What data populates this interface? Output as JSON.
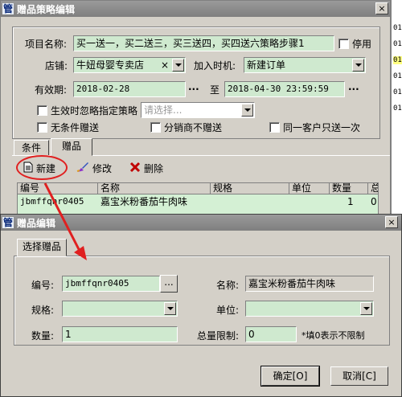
{
  "bg_window": {
    "col_values": [
      "01",
      "01",
      "01",
      "01",
      "01",
      "01"
    ]
  },
  "main_window": {
    "title": "赠品策略编辑",
    "close": "×",
    "fields": {
      "project_label": "项目名称:",
      "project_value": "买一送一，买二送三，买三送四，买四送六策略步骤1",
      "disable_label": "停用",
      "store_label": "店铺:",
      "store_value": "牛妞母婴专卖店",
      "store_clear": "×",
      "join_label": "加入时机:",
      "join_value": "新建订单",
      "valid_label": "有效期:",
      "start_date": "2018-02-28",
      "end_date": "2018-04-30 23:59:59",
      "to_label": "至",
      "dots": "...",
      "ignore_label": "生效时忽略指定策略",
      "ignore_placeholder": "请选择...",
      "unconditional_label": "无条件赠送",
      "distributor_label": "分销商不赠送",
      "same_customer_label": "同一客户只送一次"
    },
    "tabs": [
      "条件",
      "赠品"
    ],
    "toolbar": {
      "new": "新建",
      "edit": "修改",
      "delete": "删除"
    },
    "grid": {
      "headers": [
        "编号",
        "名称",
        "规格",
        "单位",
        "数量",
        "总"
      ],
      "rows": [
        {
          "code": "jbmffqnr0405",
          "name": "嘉宝米粉番茄牛肉味",
          "spec": "",
          "unit": "",
          "qty": "1",
          "total": "0"
        }
      ]
    }
  },
  "dialog": {
    "title": "赠品编辑",
    "close": "×",
    "tab": "选择赠品",
    "code_label": "编号:",
    "code_value": "jbmffqnr0405",
    "dots": "...",
    "name_label": "名称:",
    "name_value": "嘉宝米粉番茄牛肉味",
    "spec_label": "规格:",
    "unit_label": "单位:",
    "qty_label": "数量:",
    "qty_value": "1",
    "limit_label": "总量限制:",
    "limit_value": "0",
    "limit_hint": "*填0表示不限制",
    "ok": "确定[O]",
    "cancel": "取消[C]"
  },
  "colors": {
    "field_bg": "#cfe9cf",
    "accent_red": "#e02020",
    "window_bg": "#d4d0c8"
  }
}
